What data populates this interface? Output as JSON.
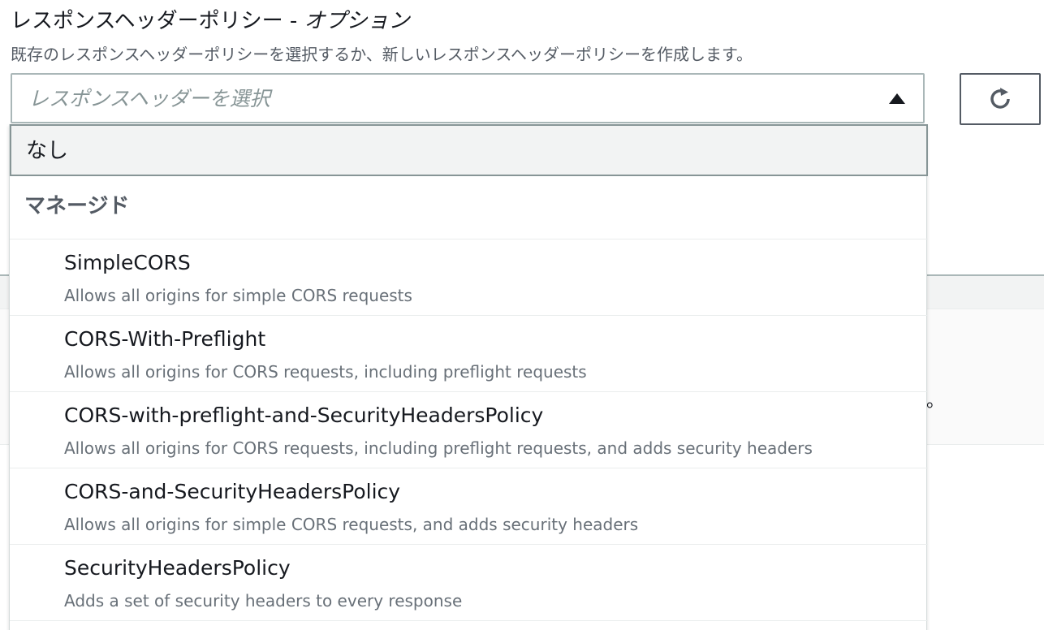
{
  "field": {
    "label": "レスポンスヘッダーポリシー - ",
    "optional": "オプション",
    "description": "既存のレスポンスヘッダーポリシーを選択するか、新しいレスポンスヘッダーポリシーを作成します。"
  },
  "select": {
    "placeholder": "レスポンスヘッダーを選択",
    "state": "expanded",
    "icon": "caret-up-icon"
  },
  "refresh_button": {
    "icon": "refresh-icon"
  },
  "dropdown": {
    "none_option": "なし",
    "group_label": "マネージド",
    "options": [
      {
        "title": "SimpleCORS",
        "description": "Allows all origins for simple CORS requests"
      },
      {
        "title": "CORS-With-Preflight",
        "description": "Allows all origins for CORS requests, including preflight requests"
      },
      {
        "title": "CORS-with-preflight-and-SecurityHeadersPolicy",
        "description": "Allows all origins for CORS requests, including preflight requests, and adds security headers"
      },
      {
        "title": "CORS-and-SecurityHeadersPolicy",
        "description": "Allows all origins for simple CORS requests, and adds security headers"
      },
      {
        "title": "SecurityHeadersPolicy",
        "description": "Adds a set of security headers to every response"
      }
    ]
  },
  "background": {
    "trailing_text": "。"
  },
  "colors": {
    "text_primary": "#16191f",
    "text_secondary": "#687078",
    "border": "#aab7b8",
    "selected_bg": "#f2f3f3"
  }
}
